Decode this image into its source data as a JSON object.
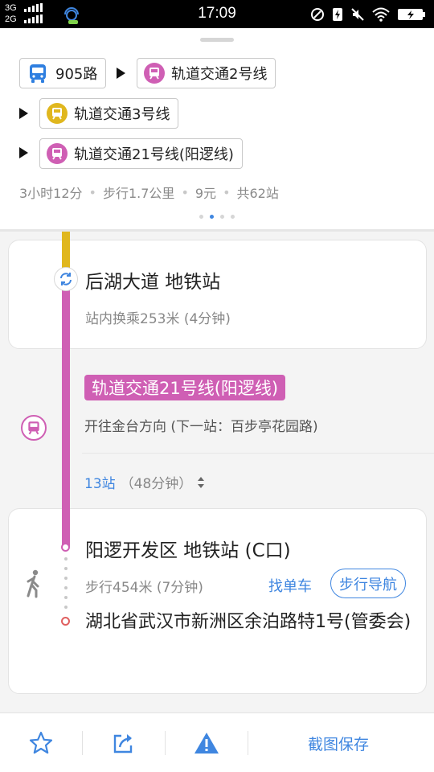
{
  "status_bar": {
    "network_top": "3G",
    "network_bottom": "2G",
    "time": "17:09"
  },
  "route_summary": {
    "segments": [
      {
        "type": "bus",
        "label": "905路",
        "icon": "bus-icon",
        "color": "#2f7fe0"
      },
      {
        "type": "metro",
        "label": "轨道交通2号线",
        "icon": "metro-icon",
        "color": "#cf5fb4"
      },
      {
        "type": "metro",
        "label": "轨道交通3号线",
        "icon": "metro-icon",
        "color": "#e0b71e"
      },
      {
        "type": "metro",
        "label": "轨道交通21号线(阳逻线)",
        "icon": "metro-icon",
        "color": "#cf5fb4"
      }
    ],
    "duration": "3小时12分",
    "walk": "步行1.7公里",
    "fare": "9元",
    "stations": "共62站",
    "separator": "•",
    "page_count": 4,
    "active_page": 1
  },
  "steps": {
    "transfer": {
      "station": "后湖大道 地铁站",
      "detail": "站内换乘253米 (4分钟)"
    },
    "ride": {
      "line": "轨道交通21号线(阳逻线)",
      "line_color": "#cf5fb4",
      "direction": "开往金台方向 (下一站：百步亭花园路)",
      "stops": "13站",
      "duration": "（48分钟）"
    },
    "arrival": {
      "station": "阳逻开发区 地铁站 (C口)",
      "walk": "步行454米 (7分钟)",
      "find_bike": "找单车",
      "walk_nav": "步行导航",
      "address": "湖北省武汉市新洲区余泊路特1号(管委会)"
    }
  },
  "bottom_bar": {
    "save_label": "截图保存"
  },
  "colors": {
    "accent": "#3f86e0",
    "line21": "#cf5fb4",
    "line3": "#e0b71e"
  }
}
